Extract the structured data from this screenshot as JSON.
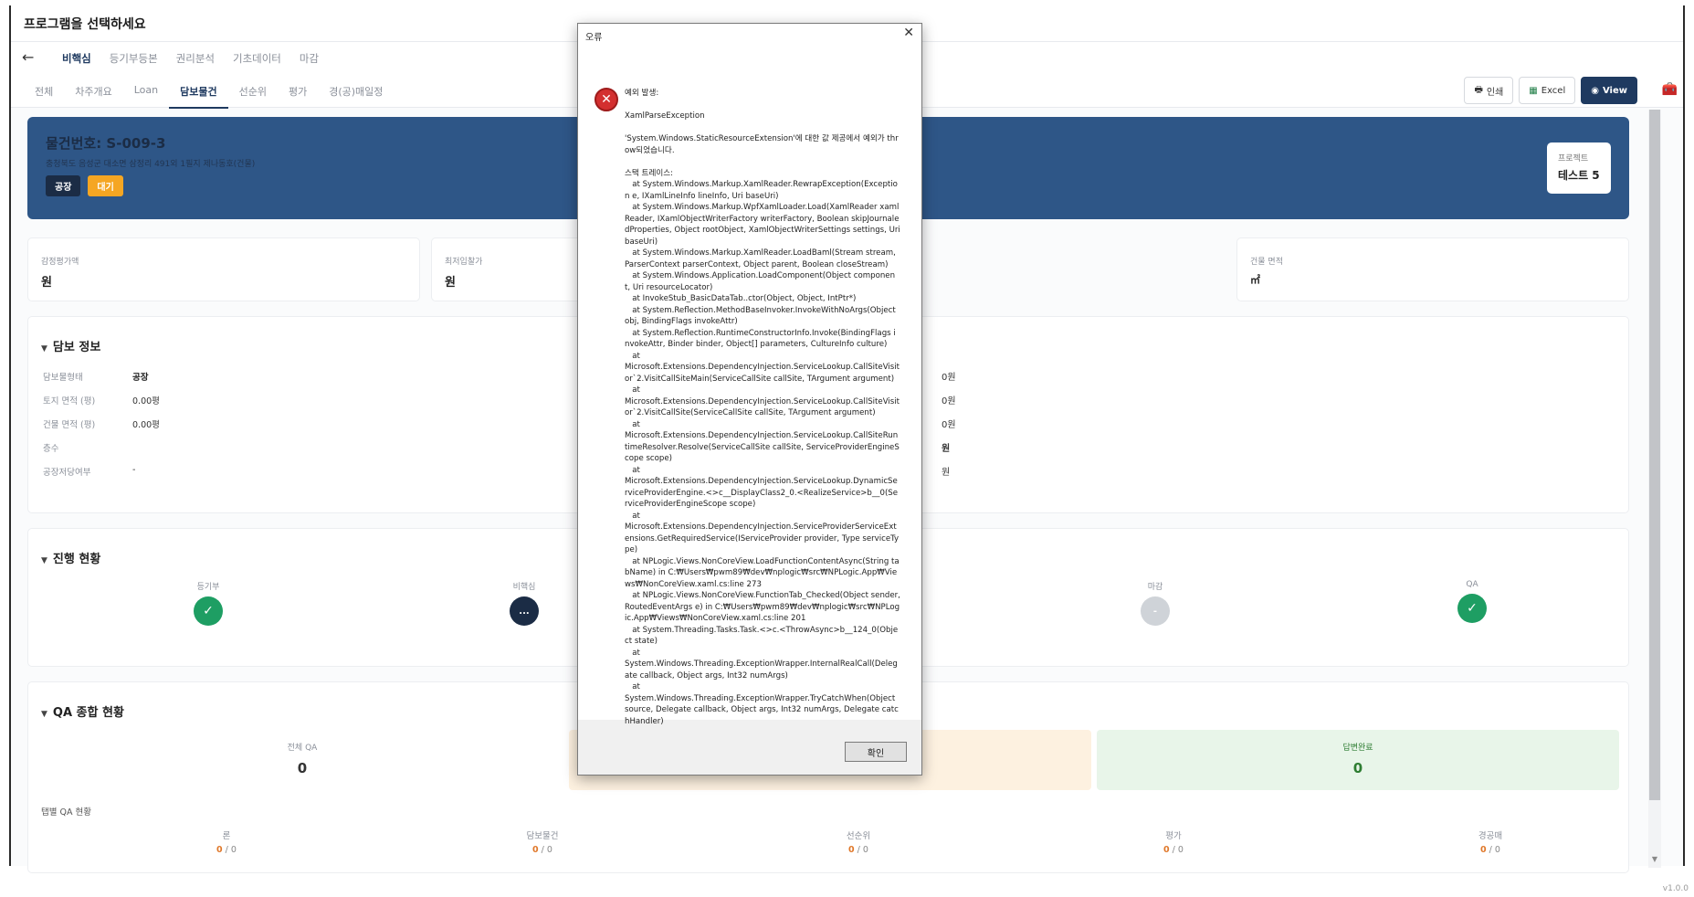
{
  "window": {
    "title": "프로그램을 선택하세요"
  },
  "top_tabs": [
    "비핵심",
    "등기부등본",
    "권리분석",
    "기초데이터",
    "마감"
  ],
  "sub_tabs": [
    "전체",
    "차주개요",
    "Loan",
    "담보물건",
    "선순위",
    "평가",
    "경(공)매일정"
  ],
  "actions": {
    "print": "인쇄",
    "excel": "Excel",
    "view": "View"
  },
  "hero": {
    "ref": "물건번호: S-009-3",
    "address": "충청북도 음성군 대소면 삼정리 491외 1필지 제나동호(건물)",
    "badge_type": "공장",
    "badge_status": "대기",
    "project_label": "프로젝트",
    "project_value": "테스트 5"
  },
  "metrics": [
    {
      "label": "감정평가액",
      "value": "원"
    },
    {
      "label": "최저입찰가",
      "value": "원"
    },
    {
      "label": "건물 면적",
      "value": "㎡"
    }
  ],
  "collateral": {
    "title": "담보 정보",
    "rows": [
      {
        "key": "담보물형태",
        "value": "공장"
      },
      {
        "key": "토지 면적 (평)",
        "value": "0.00평"
      },
      {
        "key": "건물 면적 (평)",
        "value": "0.00평"
      },
      {
        "key": "층수",
        "value": ""
      },
      {
        "key": "공장저당여부",
        "value": "-"
      }
    ],
    "right_values": [
      "0원",
      "0원",
      "0원",
      "원",
      "원"
    ]
  },
  "progress": {
    "title": "진행 현황",
    "stages": [
      {
        "label": "등기부",
        "mark": "✓"
      },
      {
        "label": "비핵심",
        "mark": "..."
      },
      {
        "label": "마감",
        "mark": "-"
      },
      {
        "label": "QA",
        "mark": "✓"
      }
    ]
  },
  "qa": {
    "title": "QA 종합 현황",
    "total_label": "전체 QA",
    "total_value": "0",
    "answered_label": "답변완료",
    "answered_value": "0",
    "tab_title": "탭별 QA 현황",
    "tabs": [
      {
        "label": "론",
        "done": "0",
        "total": "0"
      },
      {
        "label": "담보물건",
        "done": "0",
        "total": "0"
      },
      {
        "label": "선순위",
        "done": "0",
        "total": "0"
      },
      {
        "label": "평가",
        "done": "0",
        "total": "0"
      },
      {
        "label": "경공매",
        "done": "0",
        "total": "0"
      }
    ]
  },
  "dialog": {
    "title": "오류",
    "message": "예외 발생:\n\nXamlParseException\n\n'System.Windows.StaticResourceExtension'에 대한 값 제공에서 예외가 throw되었습니다.\n\n스택 트레이스:\n   at System.Windows.Markup.XamlReader.RewrapException(Exception e, IXamlLineInfo lineInfo, Uri baseUri)\n   at System.Windows.Markup.WpfXamlLoader.Load(XamlReader xamlReader, IXamlObjectWriterFactory writerFactory, Boolean skipJournaledProperties, Object rootObject, XamlObjectWriterSettings settings, Uri baseUri)\n   at System.Windows.Markup.XamlReader.LoadBaml(Stream stream, ParserContext parserContext, Object parent, Boolean closeStream)\n   at System.Windows.Application.LoadComponent(Object component, Uri resourceLocator)\n   at InvokeStub_BasicDataTab..ctor(Object, Object, IntPtr*)\n   at System.Reflection.MethodBaseInvoker.InvokeWithNoArgs(Object obj, BindingFlags invokeAttr)\n   at System.Reflection.RuntimeConstructorInfo.Invoke(BindingFlags invokeAttr, Binder binder, Object[] parameters, CultureInfo culture)\n   at\nMicrosoft.Extensions.DependencyInjection.ServiceLookup.CallSiteVisitor`2.VisitCallSiteMain(ServiceCallSite callSite, TArgument argument)\n   at\nMicrosoft.Extensions.DependencyInjection.ServiceLookup.CallSiteVisitor`2.VisitCallSite(ServiceCallSite callSite, TArgument argument)\n   at\nMicrosoft.Extensions.DependencyInjection.ServiceLookup.CallSiteRuntimeResolver.Resolve(ServiceCallSite callSite, ServiceProviderEngineScope scope)\n   at\nMicrosoft.Extensions.DependencyInjection.ServiceLookup.DynamicServiceProviderEngine.<>c__DisplayClass2_0.<RealizeService>b__0(ServiceProviderEngineScope scope)\n   at\nMicrosoft.Extensions.DependencyInjection.ServiceProviderServiceExtensions.GetRequiredService(IServiceProvider provider, Type serviceType)\n   at NPLogic.Views.NonCoreView.LoadFunctionContentAsync(String tabName) in C:₩Users₩pwm89₩dev₩nplogic₩src₩NPLogic.App₩Views₩NonCoreView.xaml.cs:line 273\n   at NPLogic.Views.NonCoreView.FunctionTab_Checked(Object sender, RoutedEventArgs e) in C:₩Users₩pwm89₩dev₩nplogic₩src₩NPLogic.App₩Views₩NonCoreView.xaml.cs:line 201\n   at System.Threading.Tasks.Task.<>c.<ThrowAsync>b__124_0(Object state)\n   at\nSystem.Windows.Threading.ExceptionWrapper.InternalRealCall(Delegate callback, Object args, Int32 numArgs)\n   at\nSystem.Windows.Threading.ExceptionWrapper.TryCatchWhen(Object source, Delegate callback, Object args, Int32 numArgs, Delegate catchHandler)",
    "ok": "확인"
  },
  "version": "v1.0.0",
  "colors": {
    "brand_navy": "#1f3a60",
    "hero": "#2e5687",
    "success": "#1e9e63",
    "warning": "#f5a623",
    "error": "#d32f2f"
  }
}
